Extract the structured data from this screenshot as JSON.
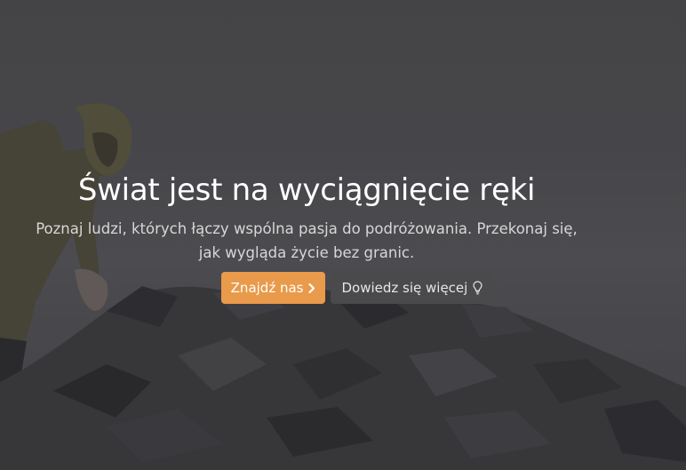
{
  "hero": {
    "headline": "Świat jest na wyciągnięcie ręki",
    "subtitle": "Poznaj ludzi, których łączy wspólna pasja do podróżowania. Przekonaj się, jak wygląda życie bez granic.",
    "primary_button": {
      "label": "Znajdź nas",
      "icon": "chevron-right-icon"
    },
    "secondary_button": {
      "label": "Dowiedz się więcej",
      "icon": "lightbulb-icon"
    }
  },
  "colors": {
    "accent": "#e99a4a",
    "overlay": "#4a4a4c",
    "headline_text": "#ffffff",
    "subtitle_text": "#d7d7d7"
  }
}
